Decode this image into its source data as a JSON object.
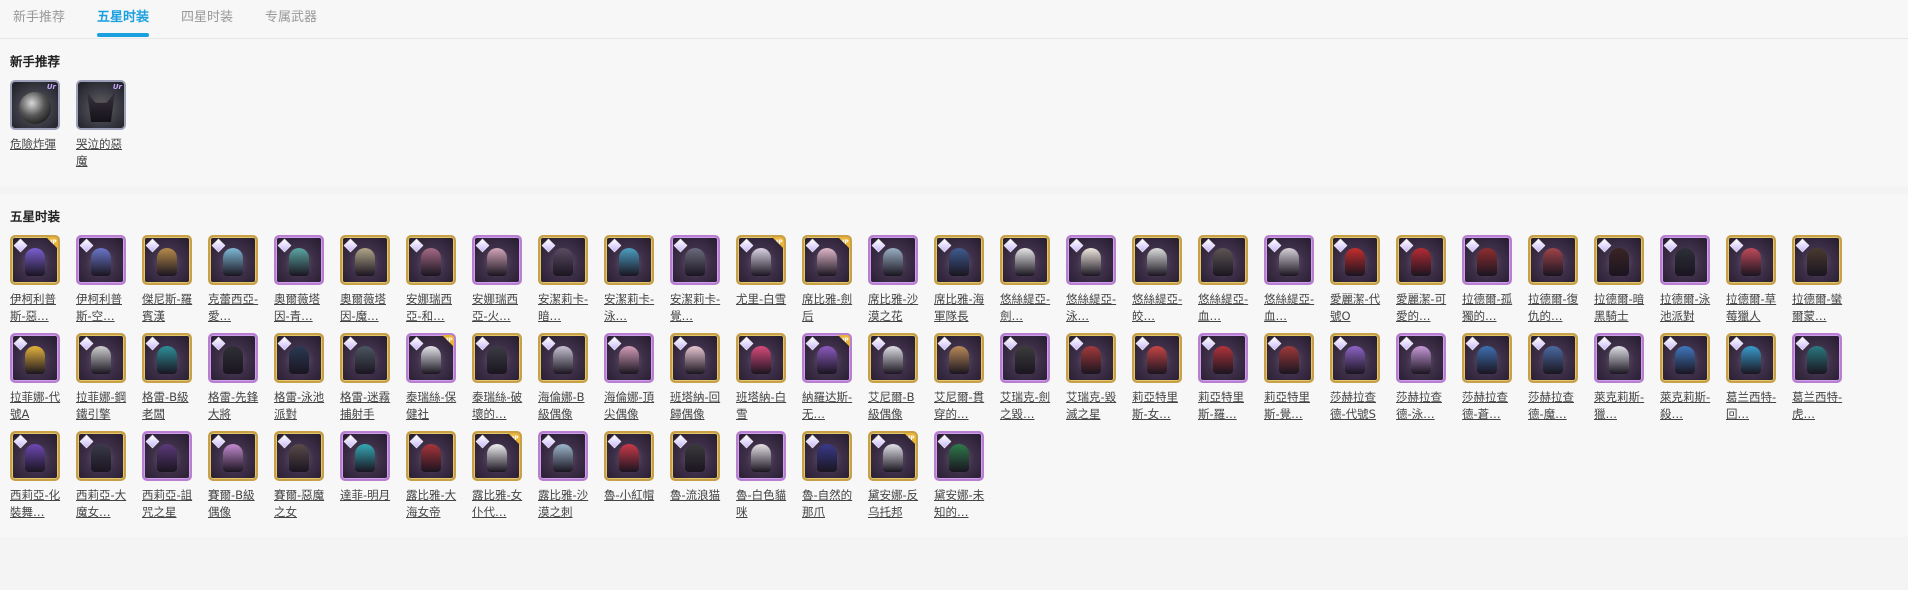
{
  "tabs": [
    {
      "label": "新手推荐",
      "active": false
    },
    {
      "label": "五星时装",
      "active": true
    },
    {
      "label": "四星时装",
      "active": false
    },
    {
      "label": "专属武器",
      "active": false
    }
  ],
  "rookie": {
    "title": "新手推荐",
    "items": [
      {
        "name": "危險炸彈",
        "icon": "bomb-icon",
        "badge": "Ur"
      },
      {
        "name": "哭泣的惡魔",
        "icon": "demon-mask-icon",
        "badge": "Ur"
      }
    ]
  },
  "five_star": {
    "title": "五星时装",
    "items": [
      {
        "name": "伊柯利普斯-惡…",
        "up": true,
        "color": "#7b5fd1"
      },
      {
        "name": "伊柯利普斯-空…",
        "up": false,
        "color": "#6a76c9"
      },
      {
        "name": "傑尼斯-羅賓漢",
        "up": false,
        "color": "#b78b4b"
      },
      {
        "name": "克蕾西亞-愛…",
        "up": false,
        "color": "#7fb9d6"
      },
      {
        "name": "奧爾薇塔因-青…",
        "up": false,
        "color": "#5aa6a0"
      },
      {
        "name": "奧爾薇塔因-魔…",
        "up": false,
        "color": "#b2a688"
      },
      {
        "name": "安娜瑞西亞-和…",
        "up": false,
        "color": "#a66a85"
      },
      {
        "name": "安娜瑞西亞-火…",
        "up": false,
        "color": "#d2a5b8"
      },
      {
        "name": "安潔莉卡-暗…",
        "up": false,
        "color": "#5b4a62"
      },
      {
        "name": "安潔莉卡-泳…",
        "up": false,
        "color": "#4c9ec2"
      },
      {
        "name": "安潔莉卡-覺…",
        "up": false,
        "color": "#6b6b7d"
      },
      {
        "name": "尤里-白雪",
        "up": true,
        "color": "#d9d2e3"
      },
      {
        "name": "席比雅-劍后",
        "up": true,
        "color": "#e0b7c8"
      },
      {
        "name": "席比雅-沙漠之花",
        "up": false,
        "color": "#9ab0c4"
      },
      {
        "name": "席比雅-海軍隊長",
        "up": false,
        "color": "#3f5b8f"
      },
      {
        "name": "悠絲緹亞-劍…",
        "up": false,
        "color": "#e6e6e6"
      },
      {
        "name": "悠絲緹亞-泳…",
        "up": false,
        "color": "#efe8df"
      },
      {
        "name": "悠絲緹亞-皎…",
        "up": false,
        "color": "#dcdcdc"
      },
      {
        "name": "悠絲緹亞-血…",
        "up": false,
        "color": "#5d5555"
      },
      {
        "name": "悠絲緹亞-血…",
        "up": false,
        "color": "#d5d0d8"
      },
      {
        "name": "愛麗潔-代號O",
        "up": false,
        "color": "#c42d2d"
      },
      {
        "name": "愛麗潔-可愛的…",
        "up": false,
        "color": "#b62b33"
      },
      {
        "name": "拉德爾-孤獨的…",
        "up": false,
        "color": "#8f2e30"
      },
      {
        "name": "拉德爾-復仇的…",
        "up": false,
        "color": "#a0444a"
      },
      {
        "name": "拉德爾-暗黑騎士",
        "up": false,
        "color": "#3a2424"
      },
      {
        "name": "拉德爾-泳池派對",
        "up": false,
        "color": "#2d2f38"
      },
      {
        "name": "拉德爾-草莓獵人",
        "up": false,
        "color": "#c04a5a"
      },
      {
        "name": "拉德爾-蠻爾蒙…",
        "up": false,
        "color": "#4a3a2e"
      },
      {
        "name": "拉菲娜-代號A",
        "up": false,
        "color": "#e5b33c"
      },
      {
        "name": "拉菲娜-鋼鐵引擎",
        "up": false,
        "color": "#cfcfcf"
      },
      {
        "name": "格雷-B級老闆",
        "up": false,
        "color": "#2d8f9a"
      },
      {
        "name": "格雷-先鋒大將",
        "up": false,
        "color": "#2f2f35"
      },
      {
        "name": "格雷-泳池派對",
        "up": false,
        "color": "#2a3a52"
      },
      {
        "name": "格雷-迷霧捕射手",
        "up": false,
        "color": "#4b5661"
      },
      {
        "name": "泰瑞絲-保健社",
        "up": true,
        "color": "#e4e4ea"
      },
      {
        "name": "泰瑞絲-破壞的…",
        "up": false,
        "color": "#3c3c45"
      },
      {
        "name": "海倫娜-B級偶像",
        "up": false,
        "color": "#c7c2d2"
      },
      {
        "name": "海倫娜-頂尖偶像",
        "up": false,
        "color": "#d29db8"
      },
      {
        "name": "班塔納-回歸偶像",
        "up": false,
        "color": "#e8c7d1"
      },
      {
        "name": "班塔納-白雪",
        "up": false,
        "color": "#d84a7a"
      },
      {
        "name": "納羅达斯-无…",
        "up": true,
        "color": "#8c5ac0"
      },
      {
        "name": "艾尼爾-B級偶像",
        "up": false,
        "color": "#dfdfe5"
      },
      {
        "name": "艾尼爾-貫穿的…",
        "up": false,
        "color": "#b98a58"
      },
      {
        "name": "艾瑞克-劍之毀…",
        "up": false,
        "color": "#3c3c3c"
      },
      {
        "name": "艾瑞克-毀滅之星",
        "up": false,
        "color": "#a43a3a"
      },
      {
        "name": "莉亞特里斯-女…",
        "up": false,
        "color": "#c54545"
      },
      {
        "name": "莉亞特里斯-羅…",
        "up": false,
        "color": "#b1343a"
      },
      {
        "name": "莉亞特里斯-覺…",
        "up": false,
        "color": "#9e3a3a"
      },
      {
        "name": "莎赫拉查德-代號S",
        "up": false,
        "color": "#8e64c7"
      },
      {
        "name": "莎赫拉查德-泳…",
        "up": false,
        "color": "#c79ad8"
      },
      {
        "name": "莎赫拉查德-蒼…",
        "up": false,
        "color": "#3e6fb0"
      },
      {
        "name": "莎赫拉查德-魔…",
        "up": false,
        "color": "#4b6aa2"
      },
      {
        "name": "萊克莉斯-獵…",
        "up": false,
        "color": "#e0e0e8"
      },
      {
        "name": "萊克莉斯-殺…",
        "up": false,
        "color": "#3f78bf"
      },
      {
        "name": "葛兰西特-回…",
        "up": false,
        "color": "#3a9ccc"
      },
      {
        "name": "葛兰西特-虎…",
        "up": false,
        "color": "#2a7880"
      },
      {
        "name": "西莉亞-化裝舞…",
        "up": false,
        "color": "#6e48b5"
      },
      {
        "name": "西莉亞-大魔女…",
        "up": false,
        "color": "#3a3a4a"
      },
      {
        "name": "西莉亞-詛咒之星",
        "up": false,
        "color": "#5b3a7a"
      },
      {
        "name": "賽爾-B級偶像",
        "up": false,
        "color": "#c48ad0"
      },
      {
        "name": "賽爾-惡魔之女",
        "up": false,
        "color": "#5a4a4a"
      },
      {
        "name": "達菲-明月",
        "up": false,
        "color": "#35a8b5"
      },
      {
        "name": "露比雅-大海女帝",
        "up": false,
        "color": "#a8343a"
      },
      {
        "name": "露比雅-女仆代…",
        "up": true,
        "color": "#efefef"
      },
      {
        "name": "露比雅-沙漠之刺",
        "up": false,
        "color": "#9db6cc"
      },
      {
        "name": "魯-小紅帽",
        "up": false,
        "color": "#c93a4a"
      },
      {
        "name": "魯-流浪猫",
        "up": false,
        "color": "#3a3a3a"
      },
      {
        "name": "魯-白色貓咪",
        "up": false,
        "color": "#e6e0e6"
      },
      {
        "name": "魯-自然的那爪",
        "up": false,
        "color": "#3a3a8a"
      },
      {
        "name": "黛安娜-反乌托邦",
        "up": true,
        "color": "#e2e2ea"
      },
      {
        "name": "黛安娜-未知的…",
        "up": false,
        "color": "#2f7a4a"
      }
    ]
  }
}
